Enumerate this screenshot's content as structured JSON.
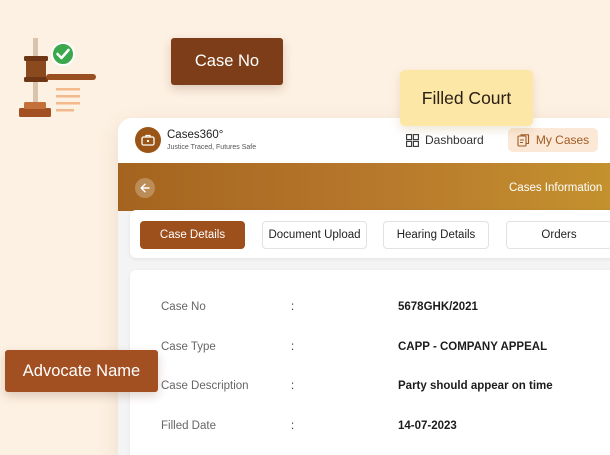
{
  "colors": {
    "background": "#fdf1e3",
    "brand": "#9d4f1c",
    "banner_start": "#a4641f",
    "banner_end": "#c4922e",
    "chip_dark": "#7c3d18",
    "chip_yellow": "#fde7a6",
    "chip_rust": "#a24f22",
    "check_green": "#3aa84b"
  },
  "illustration": {
    "icon": "gavel-with-check-icon"
  },
  "chips": {
    "case_no": "Case No",
    "filled_court": "Filled Court",
    "advocate_name": "Advocate Name"
  },
  "app": {
    "brand": {
      "name": "Cases360°",
      "tagline": "Justice Traced, Futures Safe",
      "icon": "briefcase-icon"
    },
    "nav": {
      "dashboard": {
        "label": "Dashboard",
        "icon": "grid-icon"
      },
      "my_cases": {
        "label": "My Cases",
        "icon": "cases-icon",
        "active": true
      }
    },
    "banner": {
      "back_icon": "arrow-left-icon",
      "title": "Cases Information"
    },
    "tabs": [
      {
        "label": "Case Details",
        "active": true
      },
      {
        "label": "Document Upload",
        "active": false
      },
      {
        "label": "Hearing Details",
        "active": false
      },
      {
        "label": "Orders",
        "active": false
      }
    ],
    "details": {
      "separator": ":",
      "rows": [
        {
          "label": "Case No",
          "value": "5678GHK/2021"
        },
        {
          "label": "Case Type",
          "value": "CAPP - COMPANY APPEAL"
        },
        {
          "label": "Case Description",
          "value": "Party should appear on time"
        },
        {
          "label": "Filled Date",
          "value": "14-07-2023"
        }
      ]
    }
  }
}
